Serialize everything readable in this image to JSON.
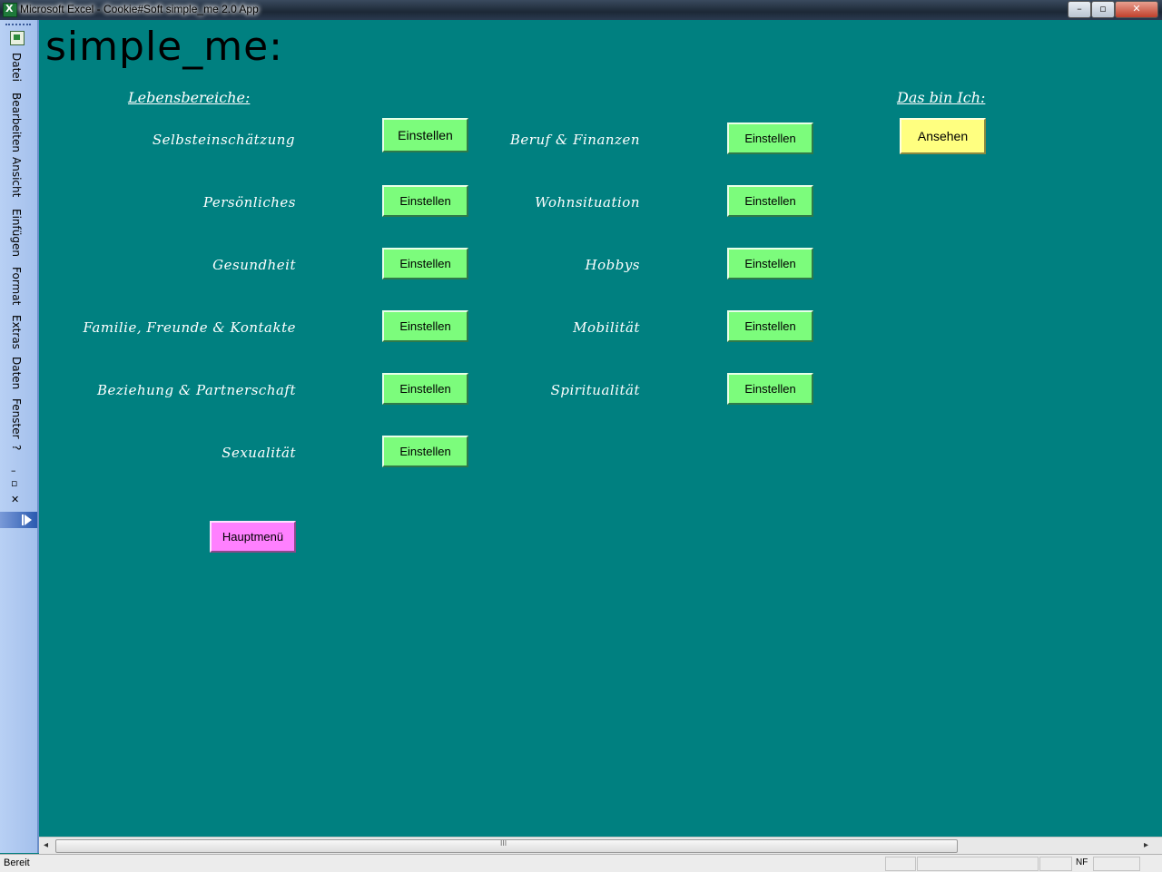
{
  "window": {
    "title": "Microsoft Excel - Cookie#Soft simple_me 2.0 App",
    "minimize_label": "–",
    "maximize_label": "▫",
    "close_label": "✕"
  },
  "menu": {
    "items": [
      "Datei",
      "Bearbeiten",
      "Ansicht",
      "Einfügen",
      "Format",
      "Extras",
      "Daten",
      "Fenster",
      "?"
    ],
    "minimize_doc": "–",
    "restore_doc": "▫",
    "close_doc": "✕"
  },
  "page": {
    "title": "simple_me:",
    "lebensbereiche_heading": "Lebensbereiche:",
    "das_bin_ich_heading": "Das bin Ich:"
  },
  "categories_left": [
    {
      "label": "Selbsteinschätzung",
      "button": "Einstellen"
    },
    {
      "label": "Persönliches",
      "button": "Einstellen"
    },
    {
      "label": "Gesundheit",
      "button": "Einstellen"
    },
    {
      "label": "Familie, Freunde & Kontakte",
      "button": "Einstellen"
    },
    {
      "label": "Beziehung & Partnerschaft",
      "button": "Einstellen"
    },
    {
      "label": "Sexualität",
      "button": "Einstellen"
    }
  ],
  "categories_right": [
    {
      "label": "Beruf & Finanzen",
      "button": "Einstellen"
    },
    {
      "label": "Wohnsituation",
      "button": "Einstellen"
    },
    {
      "label": "Hobbys",
      "button": "Einstellen"
    },
    {
      "label": "Mobilität",
      "button": "Einstellen"
    },
    {
      "label": "Spiritualität",
      "button": "Einstellen"
    }
  ],
  "ansehen_button": "Ansehen",
  "hauptmenu_button": "Hauptmenü",
  "colors": {
    "sheet_background": "#008080",
    "einstellen_button": "#7CFC7C",
    "ansehen_button": "#FFFF80",
    "hauptmenu_button": "#FF80FF"
  },
  "statusbar": {
    "status": "Bereit",
    "indicator": "NF"
  }
}
